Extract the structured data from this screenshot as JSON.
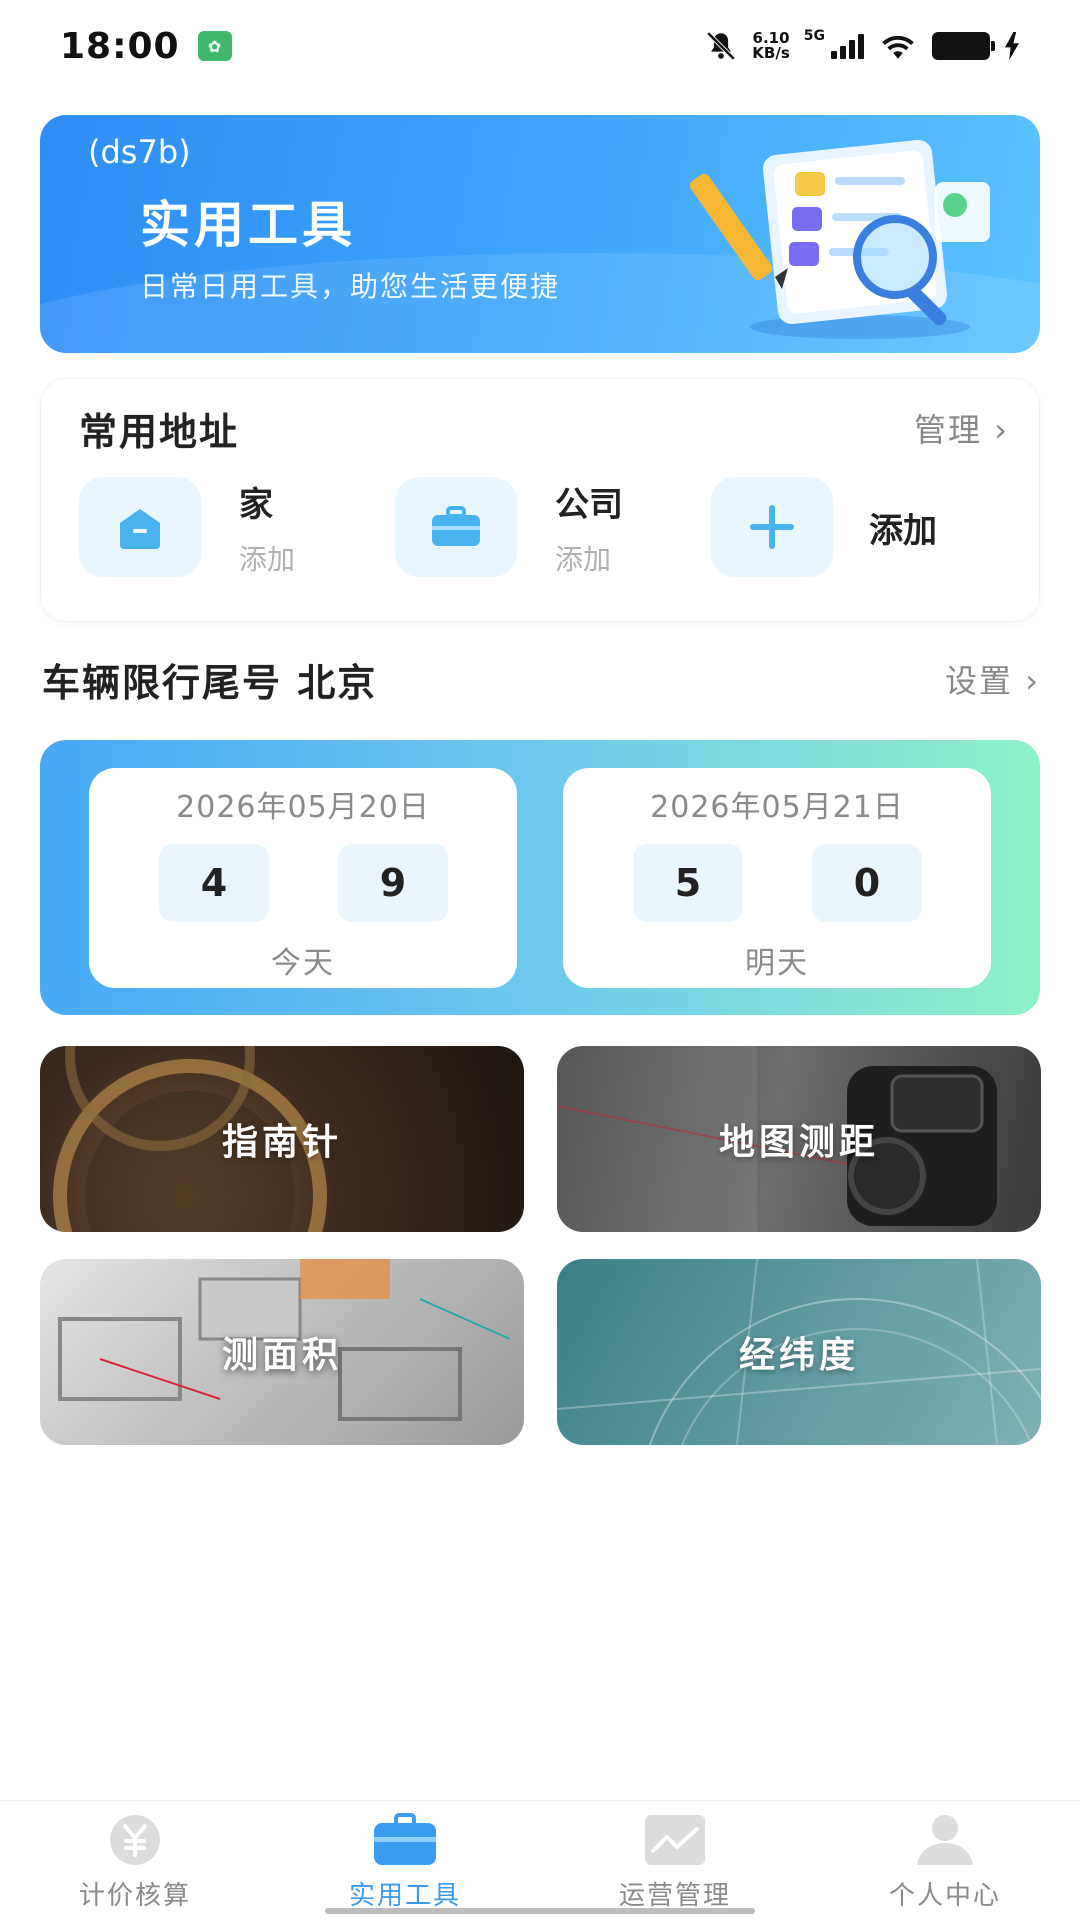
{
  "status_bar": {
    "time": "18:00",
    "net_speed_top": "6.10",
    "net_speed_bottom": "KB/s",
    "network": "5G",
    "icons": [
      "app-notification-icon",
      "bell-muted-icon",
      "signal-icon",
      "wifi-icon",
      "battery-icon",
      "charging-icon"
    ]
  },
  "banner": {
    "code": "(ds7b)",
    "title": "实用工具",
    "subtitle": "日常日用工具，助您生活更便捷"
  },
  "address": {
    "title": "常用地址",
    "manage": "管理 ›",
    "items": [
      {
        "name": "家",
        "status": "添加",
        "icon": "home-icon"
      },
      {
        "name": "公司",
        "status": "添加",
        "icon": "briefcase-icon"
      },
      {
        "name": "添加",
        "icon": "plus-icon"
      }
    ]
  },
  "restriction": {
    "title": "车辆限行尾号  北京",
    "setting": "设置 ›",
    "days": [
      {
        "date": "2026年05月20日",
        "digits": [
          "4",
          "9"
        ],
        "label": "今天"
      },
      {
        "date": "2026年05月21日",
        "digits": [
          "5",
          "0"
        ],
        "label": "明天"
      }
    ]
  },
  "tools": [
    {
      "label": "指南针"
    },
    {
      "label": "地图测距"
    },
    {
      "label": "测面积"
    },
    {
      "label": "经纬度"
    }
  ],
  "nav": {
    "items": [
      {
        "label": "计价核算",
        "icon": "yuan-icon",
        "active": false
      },
      {
        "label": "实用工具",
        "icon": "toolbox-icon",
        "active": true
      },
      {
        "label": "运营管理",
        "icon": "chart-icon",
        "active": false
      },
      {
        "label": "个人中心",
        "icon": "user-icon",
        "active": false
      }
    ]
  },
  "colors": {
    "accent": "#3a9cf0",
    "banner_start": "#2e8df5",
    "panel_end": "#8ef2c8"
  }
}
